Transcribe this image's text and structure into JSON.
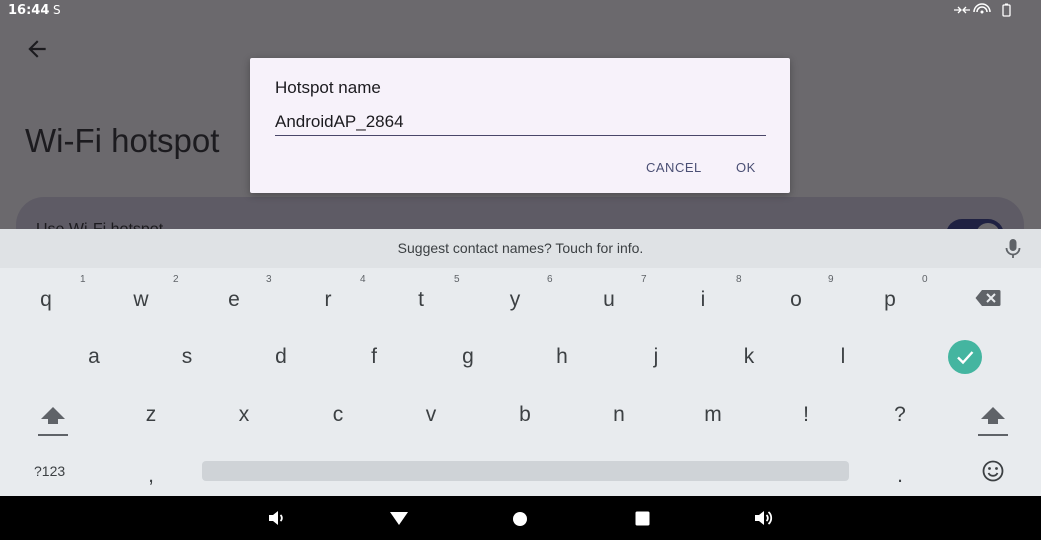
{
  "status_bar": {
    "time": "16:44",
    "left_icon": "S",
    "right_icons": [
      "data-transfer-icon",
      "hotspot-icon",
      "battery-icon"
    ]
  },
  "screen": {
    "back_icon": "back-arrow-icon",
    "title": "Wi-Fi hotspot",
    "card_label": "Use Wi-Fi hotspot",
    "toggle_on": true
  },
  "dialog": {
    "title": "Hotspot name",
    "input_value": "AndroidAP_2864",
    "cancel_label": "CANCEL",
    "ok_label": "OK"
  },
  "keyboard": {
    "suggestion": "Suggest contact names? Touch for info.",
    "row1": [
      "q",
      "w",
      "e",
      "r",
      "t",
      "y",
      "u",
      "i",
      "o",
      "p"
    ],
    "row1_hints": [
      "1",
      "2",
      "3",
      "4",
      "5",
      "6",
      "7",
      "8",
      "9",
      "0"
    ],
    "row2": [
      "a",
      "s",
      "d",
      "f",
      "g",
      "h",
      "j",
      "k",
      "l"
    ],
    "row3": [
      "z",
      "x",
      "c",
      "v",
      "b",
      "n",
      "m",
      "!",
      "?"
    ],
    "symbols_label": "?123",
    "comma": ",",
    "period": ".",
    "accent_color": "#44b5a0"
  },
  "nav_bar": {
    "icons": [
      "volume-down-icon",
      "back-triangle-icon",
      "home-circle-icon",
      "recents-square-icon",
      "volume-up-icon"
    ]
  }
}
